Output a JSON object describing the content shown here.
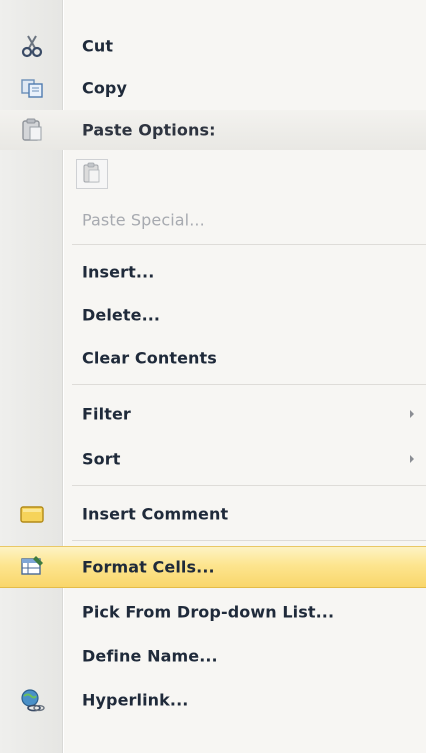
{
  "menu": {
    "items": [
      {
        "label": "Cut",
        "icon": "scissors-icon"
      },
      {
        "label": "Copy",
        "icon": "copy-icon"
      },
      {
        "label": "Paste Options:",
        "icon": "clipboard-icon"
      },
      {
        "label": "Paste Special...",
        "disabled": true
      },
      {
        "label": "Insert..."
      },
      {
        "label": "Delete..."
      },
      {
        "label": "Clear Contents"
      },
      {
        "label": "Filter",
        "submenu": true
      },
      {
        "label": "Sort",
        "submenu": true
      },
      {
        "label": "Insert Comment",
        "icon": "comment-icon"
      },
      {
        "label": "Format Cells...",
        "icon": "format-cells-icon",
        "highlighted": true
      },
      {
        "label": "Pick From Drop-down List..."
      },
      {
        "label": "Define Name..."
      },
      {
        "label": "Hyperlink...",
        "icon": "hyperlink-globe-icon"
      }
    ]
  },
  "colors": {
    "highlight": "#fde58f",
    "text": "#1f2a3a",
    "disabled_text": "#a7aab0"
  }
}
